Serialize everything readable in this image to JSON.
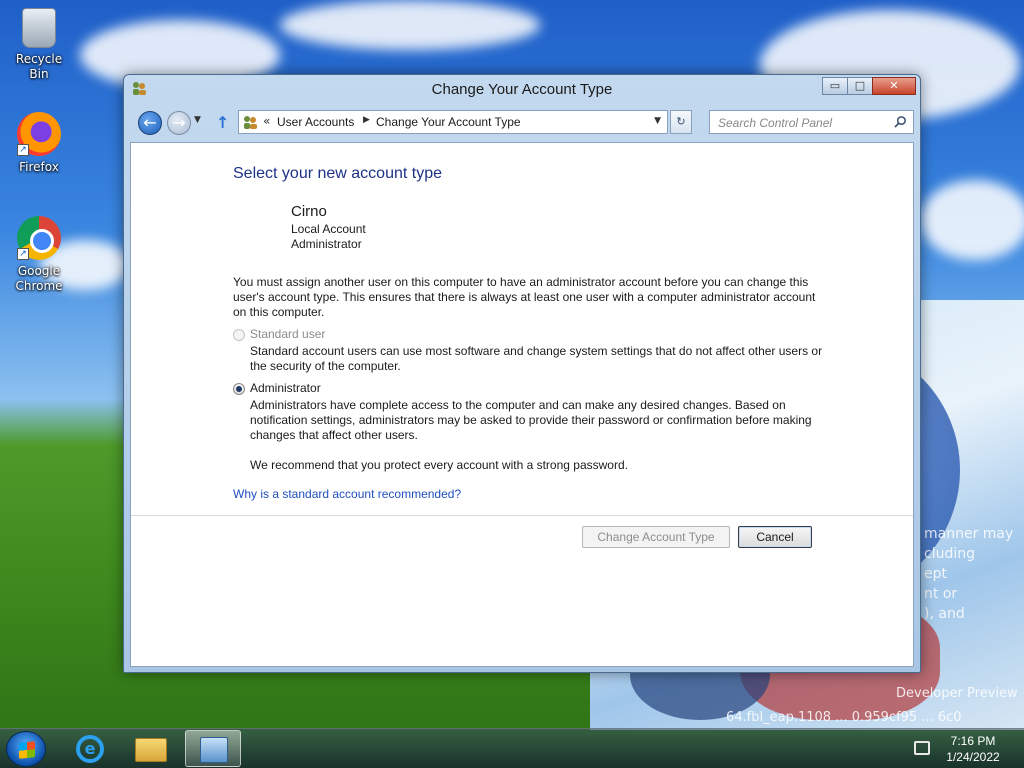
{
  "desktop": {
    "icons": [
      {
        "label": "Recycle Bin"
      },
      {
        "label": "Firefox"
      },
      {
        "label": "Google Chrome"
      }
    ],
    "watermark": {
      "line1": "manner may",
      "line2": "cluding",
      "line3": "ept",
      "line4": "nt or",
      "line5": "), and",
      "build_title": "Developer Preview",
      "build_string": "64.fbl_eap.1108 ... 0.959cf95 ... 6c0"
    }
  },
  "window": {
    "title": "Change Your Account Type",
    "controls": {
      "minimize": "▭",
      "maximize": "□",
      "close": "✕"
    },
    "nav": {
      "breadcrumb_prefix": "«",
      "breadcrumbs": [
        "User Accounts",
        "Change Your Account Type"
      ],
      "search_placeholder": "Search Control Panel"
    },
    "content": {
      "heading": "Select your new account type",
      "user": {
        "name": "Cirno",
        "account_location": "Local Account",
        "account_type": "Administrator"
      },
      "warning": "You must assign another user on this computer to have an administrator account before you can change this user's account type. This ensures that there is always at least one user with a computer administrator account on this computer.",
      "options": [
        {
          "label": "Standard user",
          "description": "Standard account users can use most software and change system settings that do not affect other users or the security of the computer.",
          "selected": false,
          "enabled": false
        },
        {
          "label": "Administrator",
          "description": "Administrators have complete access to the computer and can make any desired changes. Based on notification settings, administrators may be asked to provide their password or confirmation before making changes that affect other users.",
          "selected": true,
          "enabled": true
        }
      ],
      "recommendation": "We recommend that you protect every account with a strong password.",
      "help_link": "Why is a standard account recommended?",
      "buttons": {
        "change": "Change Account Type",
        "cancel": "Cancel"
      }
    }
  },
  "taskbar": {
    "apps": [
      "internet-explorer",
      "file-explorer",
      "control-panel"
    ],
    "clock": {
      "time": "7:16 PM",
      "date": "1/24/2022"
    }
  },
  "colors": {
    "heading": "#1e3287",
    "link": "#1f4fbf",
    "window_frame": "#a9c6e6"
  }
}
